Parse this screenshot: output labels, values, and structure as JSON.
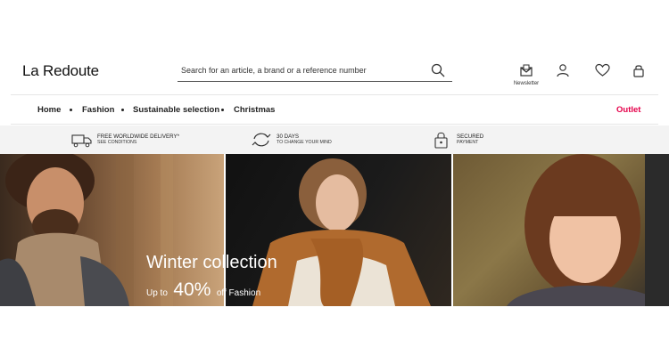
{
  "header": {
    "logo": "La Redoute",
    "search_placeholder": "Search for an article, a brand or a reference number",
    "newsletter_label": "Newsletter"
  },
  "nav": {
    "items": [
      {
        "label": "Home"
      },
      {
        "label": "Fashion"
      },
      {
        "label": "Sustainable selection"
      },
      {
        "label": "Christmas"
      }
    ],
    "outlet": "Outlet",
    "outlet_color": "#e5004a"
  },
  "reassurance": [
    {
      "icon": "truck-icon",
      "title": "FREE WORLDWIDE DELIVERY*",
      "sub": "SEE CONDITIONS"
    },
    {
      "icon": "return-arrows-icon",
      "title": "30 DAYS",
      "sub": "TO CHANGE YOUR MIND"
    },
    {
      "icon": "padlock-icon",
      "title": "SECURED",
      "sub": "PAYMENT"
    }
  ],
  "hero": {
    "headline": "Winter collection",
    "prefix": "Up to",
    "percent": "40%",
    "suffix": "off Fashion"
  }
}
